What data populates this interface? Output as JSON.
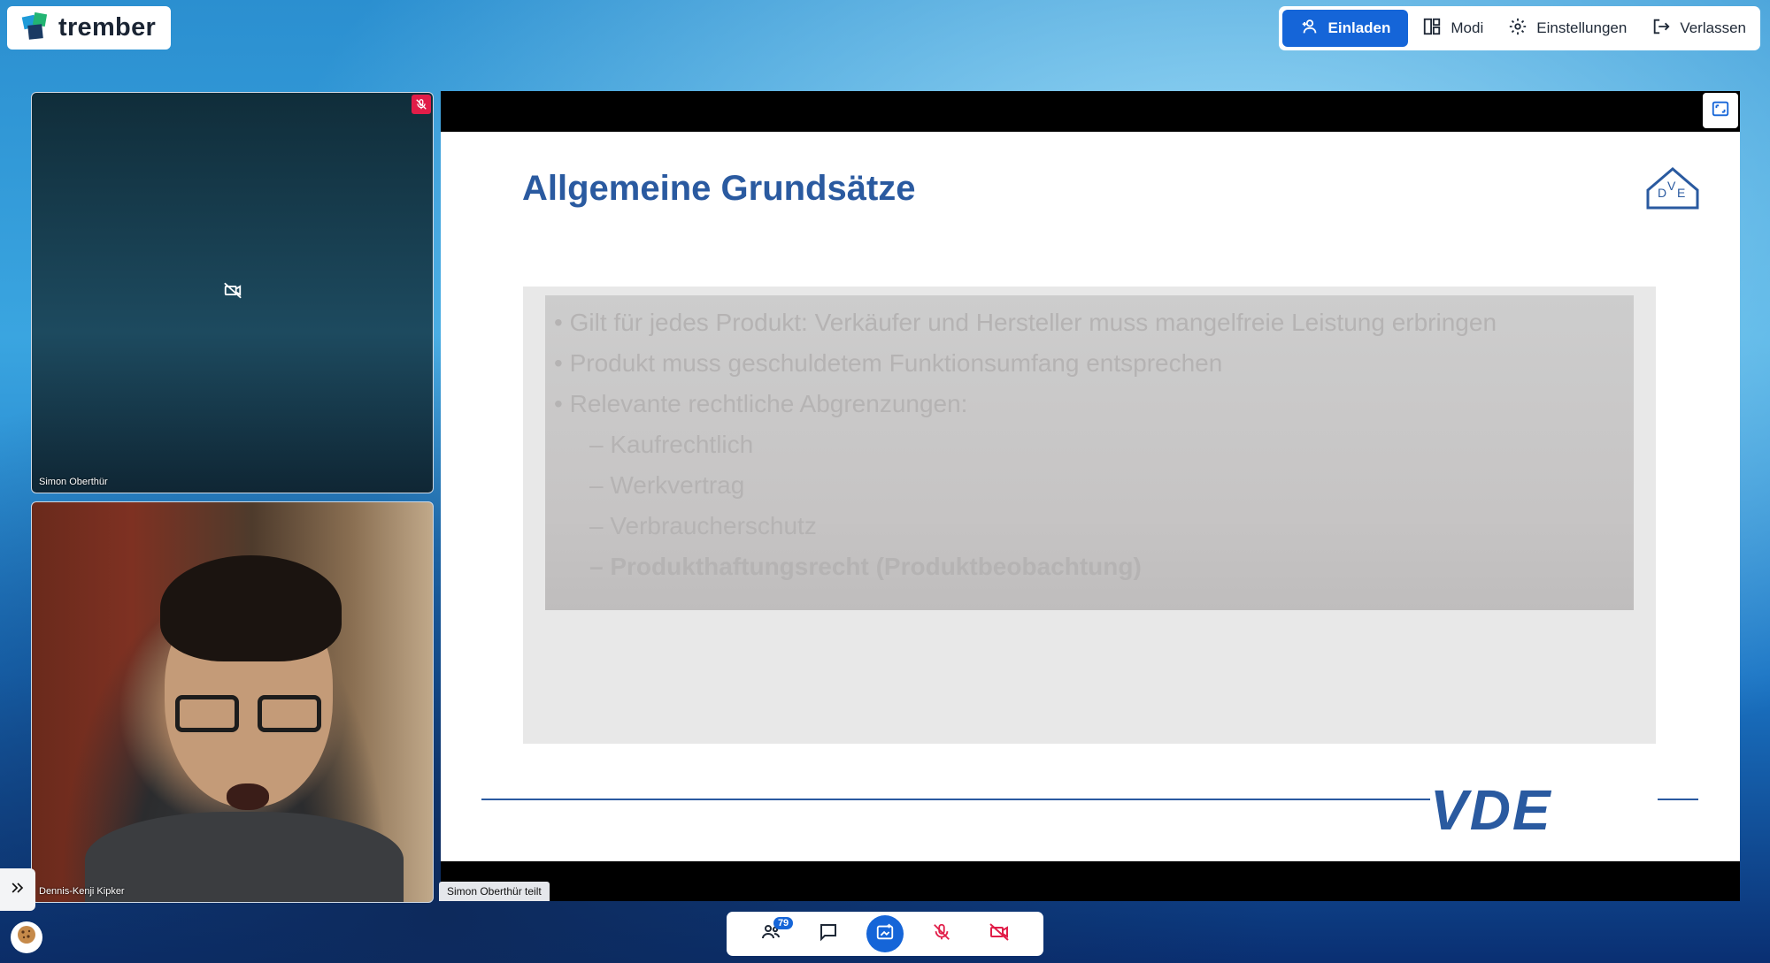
{
  "app": {
    "brand": "trember"
  },
  "topbar": {
    "invite_label": "Einladen",
    "modes_label": "Modi",
    "settings_label": "Einstellungen",
    "leave_label": "Verlassen"
  },
  "participants": [
    {
      "name": "Simon Oberthür",
      "camera": "off",
      "muted": true
    },
    {
      "name": "Dennis-Kenji Kipker",
      "camera": "on",
      "muted": false
    }
  ],
  "share": {
    "sharer_label": "Simon Oberthür teilt",
    "slide": {
      "title": "Allgemeine Grundsätze",
      "bullets": [
        {
          "text": "Gilt für jedes Produkt: Verkäufer und Hersteller muss mangelfreie Leistung erbringen",
          "level": 1
        },
        {
          "text": "Produkt muss geschuldetem Funktionsumfang entsprechen",
          "level": 1
        },
        {
          "text": "Relevante rechtliche Abgrenzungen:",
          "level": 1
        },
        {
          "text": "Kaufrechtlich",
          "level": 2
        },
        {
          "text": "Werkvertrag",
          "level": 2
        },
        {
          "text": "Verbraucherschutz",
          "level": 2
        },
        {
          "text": "Produkthaftungsrecht (Produktbeobachtung)",
          "level": 2,
          "strong": true
        }
      ],
      "footer_logo": "VDE",
      "header_logo": "VDE"
    }
  },
  "dock": {
    "participant_count": "79"
  },
  "colors": {
    "accent": "#1565d8",
    "slide_blue": "#2a5aa0",
    "mute_red": "#e11d48"
  },
  "icons": [
    "trember-logo-icon",
    "add-user-icon",
    "layout-icon",
    "gear-icon",
    "exit-icon",
    "mic-off-icon",
    "camera-off-icon",
    "fit-screen-icon",
    "expand-icon",
    "cookie-icon",
    "participants-icon",
    "chat-icon",
    "share-screen-icon"
  ]
}
